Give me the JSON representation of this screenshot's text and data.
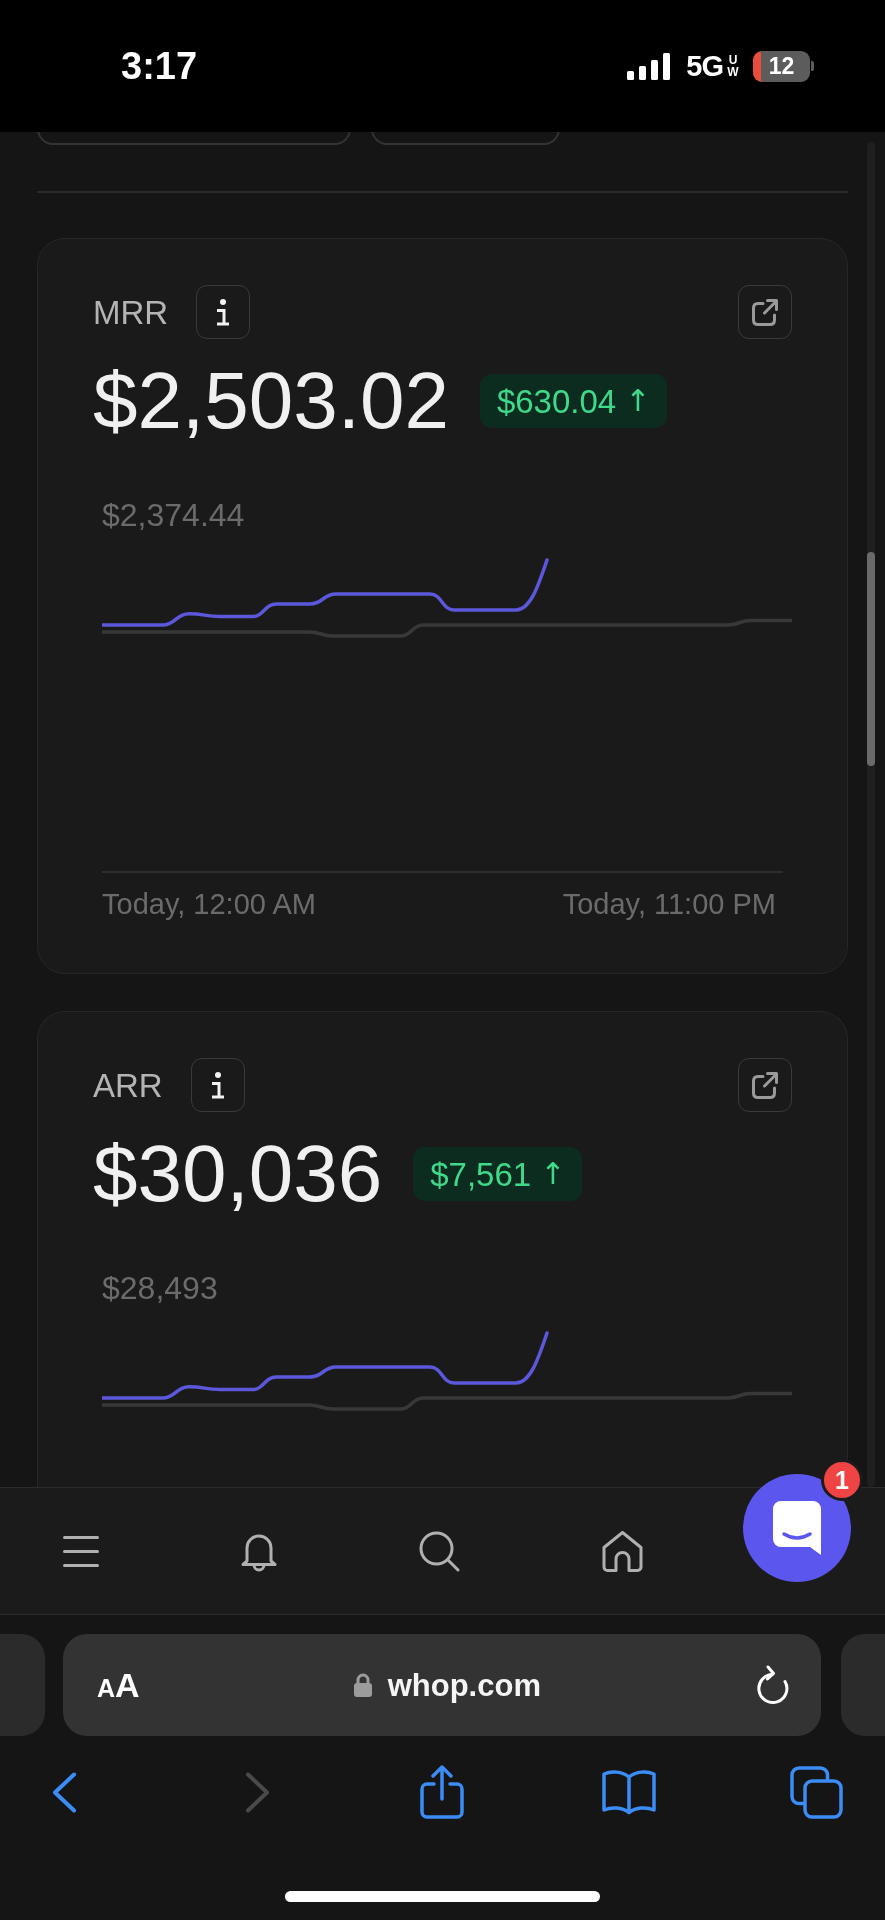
{
  "status_bar": {
    "time": "3:17",
    "network": "5G",
    "network_band": "UW",
    "battery": "12"
  },
  "metrics": [
    {
      "label": "MRR",
      "value": "$2,503.02",
      "change": "$630.04",
      "arrow": "↑",
      "chart": {
        "reference_label": "$2,374.44",
        "x_labels": [
          "Today, 12:00 AM",
          "Today, 11:00 PM"
        ]
      }
    },
    {
      "label": "ARR",
      "value": "$30,036",
      "change": "$7,561",
      "arrow": "↑",
      "chart": {
        "reference_label": "$28,493"
      }
    }
  ],
  "chat_button": {
    "badge": "1"
  },
  "address_bar": {
    "format_button": "AA",
    "url": "whop.com",
    "secure": true
  },
  "browser_toolbar": {
    "back": {
      "disabled": false
    },
    "forward": {
      "disabled": true
    }
  }
}
